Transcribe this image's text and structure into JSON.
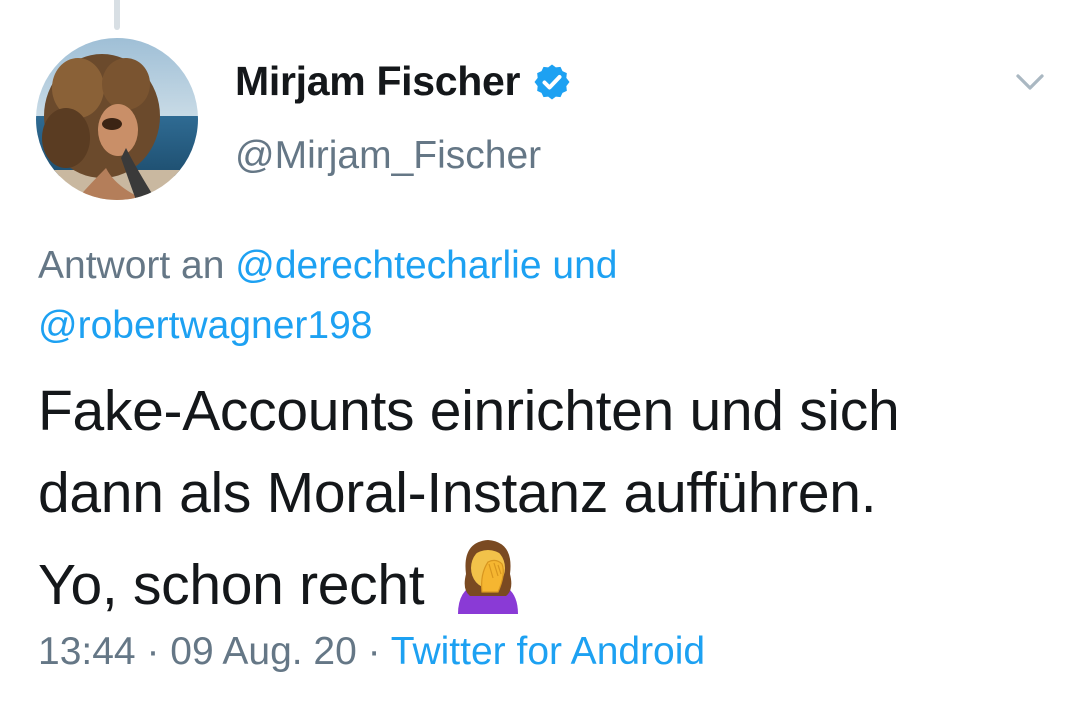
{
  "user": {
    "display_name": "Mirjam Fischer",
    "handle": "@Mirjam_Fischer",
    "verified": true,
    "verified_color": "#1da1f2"
  },
  "reply": {
    "prefix": "Antwort an",
    "mention_1": "@derechtecharlie",
    "conjunction": "und",
    "mention_2": "@robertwagner198"
  },
  "tweet": {
    "line_1": "Fake-Accounts einrichten und sich",
    "line_2": "dann als Moral-Instanz aufführen.",
    "line_3": "Yo, schon recht",
    "emoji": "facepalm-woman"
  },
  "meta": {
    "time": "13:44",
    "separator": "·",
    "date": "09 Aug. 20",
    "source": "Twitter for Android"
  },
  "colors": {
    "text": "#14171a",
    "secondary": "#657786",
    "link": "#1da1f2"
  }
}
